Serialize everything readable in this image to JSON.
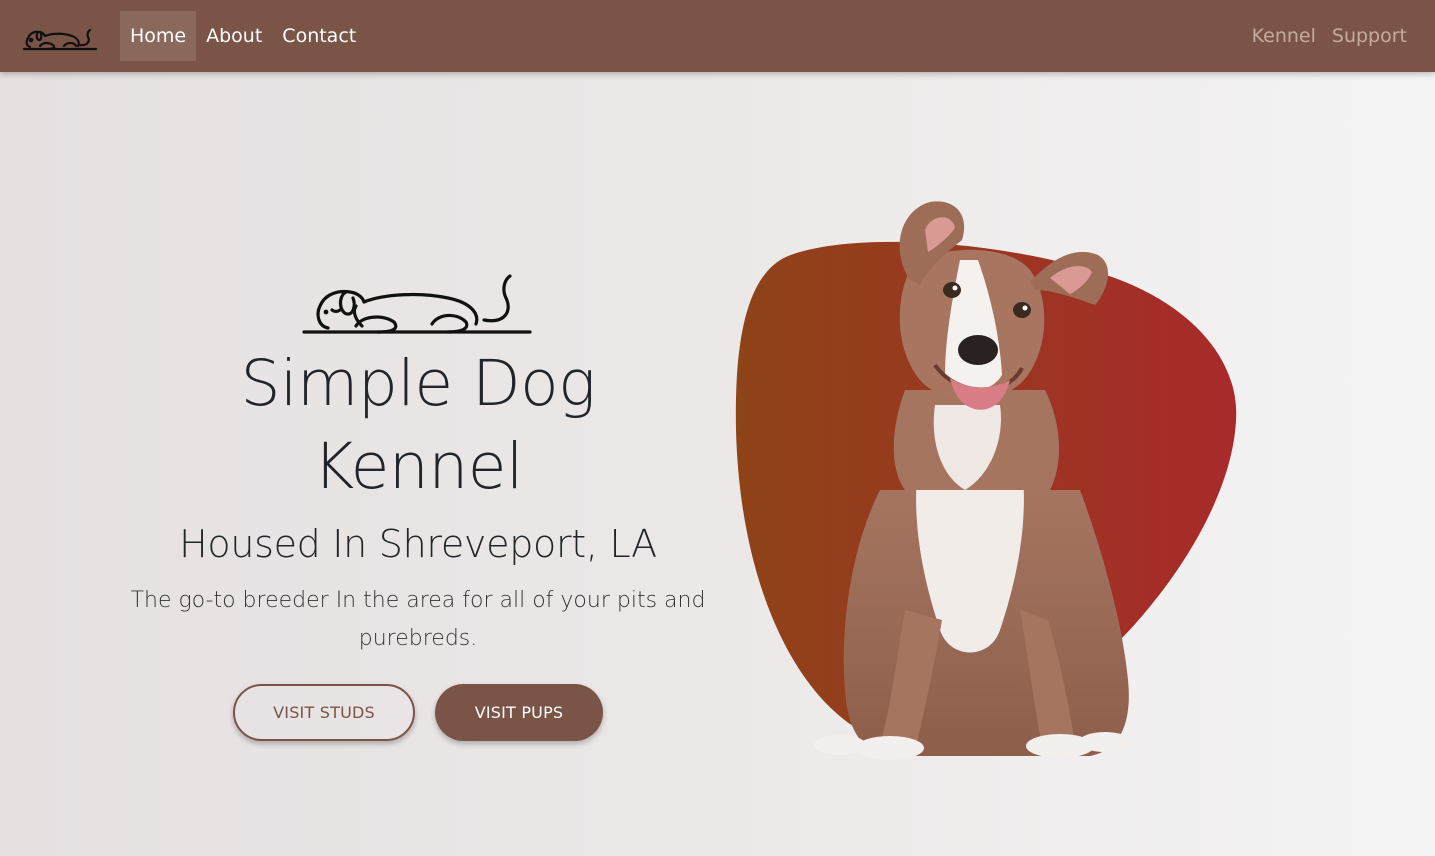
{
  "nav": {
    "brand_icon": "dog-logo-icon",
    "left_links": [
      {
        "label": "Home",
        "active": true
      },
      {
        "label": "About",
        "active": false
      },
      {
        "label": "Contact",
        "active": false
      }
    ],
    "right_links": [
      {
        "label": "Kennel"
      },
      {
        "label": "Support"
      }
    ],
    "background": "#7a5446"
  },
  "hero": {
    "logo_icon": "sleeping-dog-icon",
    "title_line1": "Simple Dog",
    "title_line2": "Kennel",
    "subtitle": "Housed In Shreveport, LA",
    "description_line1": "The go-to breeder In the area for all of your pits and",
    "description_line2": "purebreds.",
    "buttons": {
      "studs_label": "VISIT STUDS",
      "pups_label": "VISIT PUPS"
    },
    "image_icon": "dog-photo",
    "blob_colors": [
      "#8e4318",
      "#a82a2a"
    ]
  },
  "colors": {
    "accent": "#7a5446",
    "nav_right_link": "#c6aba0"
  }
}
